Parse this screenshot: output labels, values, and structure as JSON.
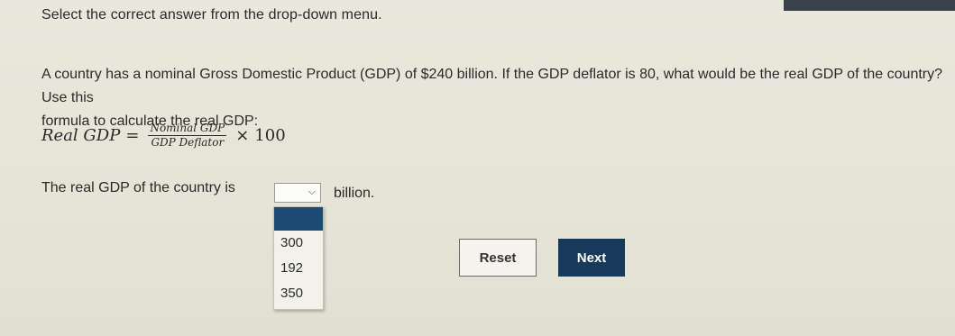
{
  "instruction": "Select the correct answer from the drop-down menu.",
  "question": {
    "line1": "A country has a nominal Gross Domestic Product (GDP) of $240 billion. If the GDP deflator is 80, what would be the real GDP of the country? Use this",
    "line2": "formula to calculate the real GDP:"
  },
  "formula": {
    "lhs": "Real GDP",
    "equals": "=",
    "numerator": "Nominal GDP",
    "denominator": "GDP Deflator",
    "times": "×",
    "multiplier": "100"
  },
  "answer": {
    "prefix": "The real GDP of the country is",
    "suffix": "billion.",
    "selected_value": "",
    "options": [
      "300",
      "192",
      "350"
    ]
  },
  "buttons": {
    "reset_label": "Reset",
    "next_label": "Next"
  },
  "colors": {
    "next_button_bg": "#173a5c",
    "dropdown_highlight": "#1d4a73",
    "top_bar": "#37424d"
  }
}
